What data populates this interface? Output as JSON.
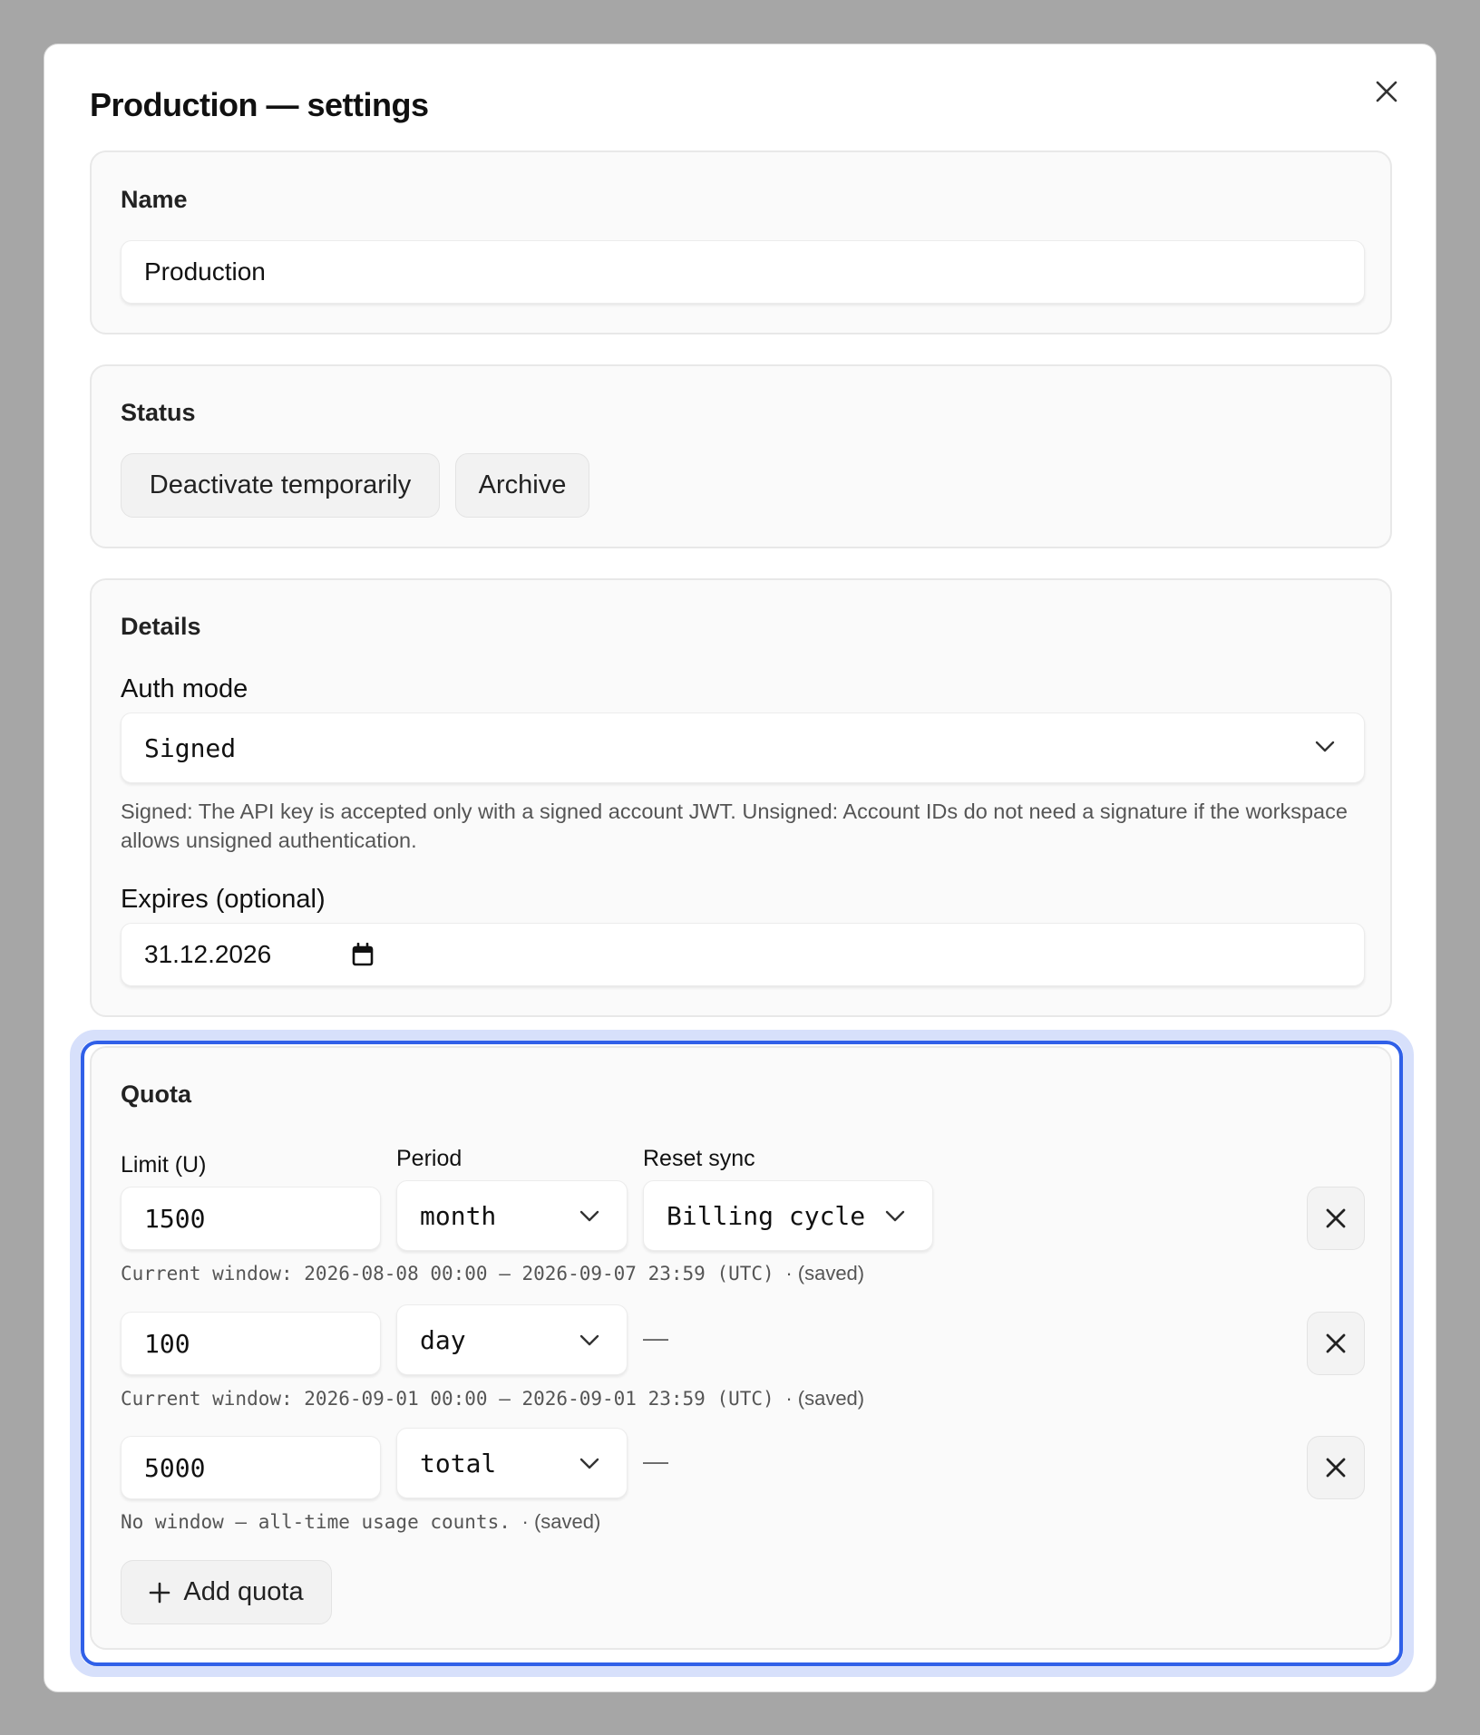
{
  "dialog": {
    "title": "Production — settings",
    "close_icon": "close-icon"
  },
  "name_section": {
    "title": "Name",
    "value": "Production"
  },
  "status_section": {
    "title": "Status",
    "deactivate_label": "Deactivate temporarily",
    "archive_label": "Archive"
  },
  "details_section": {
    "title": "Details",
    "auth_label": "Auth mode",
    "auth_value": "Signed",
    "auth_help": "Signed: The API key is accepted only with a signed account JWT. Unsigned: Account IDs do not need a signature if the workspace allows unsigned authentication.",
    "expires_label": "Expires (optional)",
    "expires_value": "31.12.2026"
  },
  "quota_section": {
    "title": "Quota",
    "limit_header": "Limit (U)",
    "period_header": "Period",
    "reset_header": "Reset sync",
    "rows": [
      {
        "limit": "1500",
        "period": "month",
        "reset": "Billing cycle",
        "window": "Current window: 2026-08-08 00:00 – 2026-09-07 23:59 (UTC)",
        "saved": "· (saved)"
      },
      {
        "limit": "100",
        "period": "day",
        "reset": "—",
        "window": "Current window: 2026-09-01 00:00 – 2026-09-01 23:59 (UTC)",
        "saved": "· (saved)"
      },
      {
        "limit": "5000",
        "period": "total",
        "reset": "—",
        "window": "No window — all-time usage counts.",
        "saved": "· (saved)"
      }
    ],
    "add_label": "Add quota"
  },
  "colors": {
    "accent": "#3060e8",
    "accent_halo": "#d7e0fb",
    "backdrop": "#a6a6a6"
  }
}
